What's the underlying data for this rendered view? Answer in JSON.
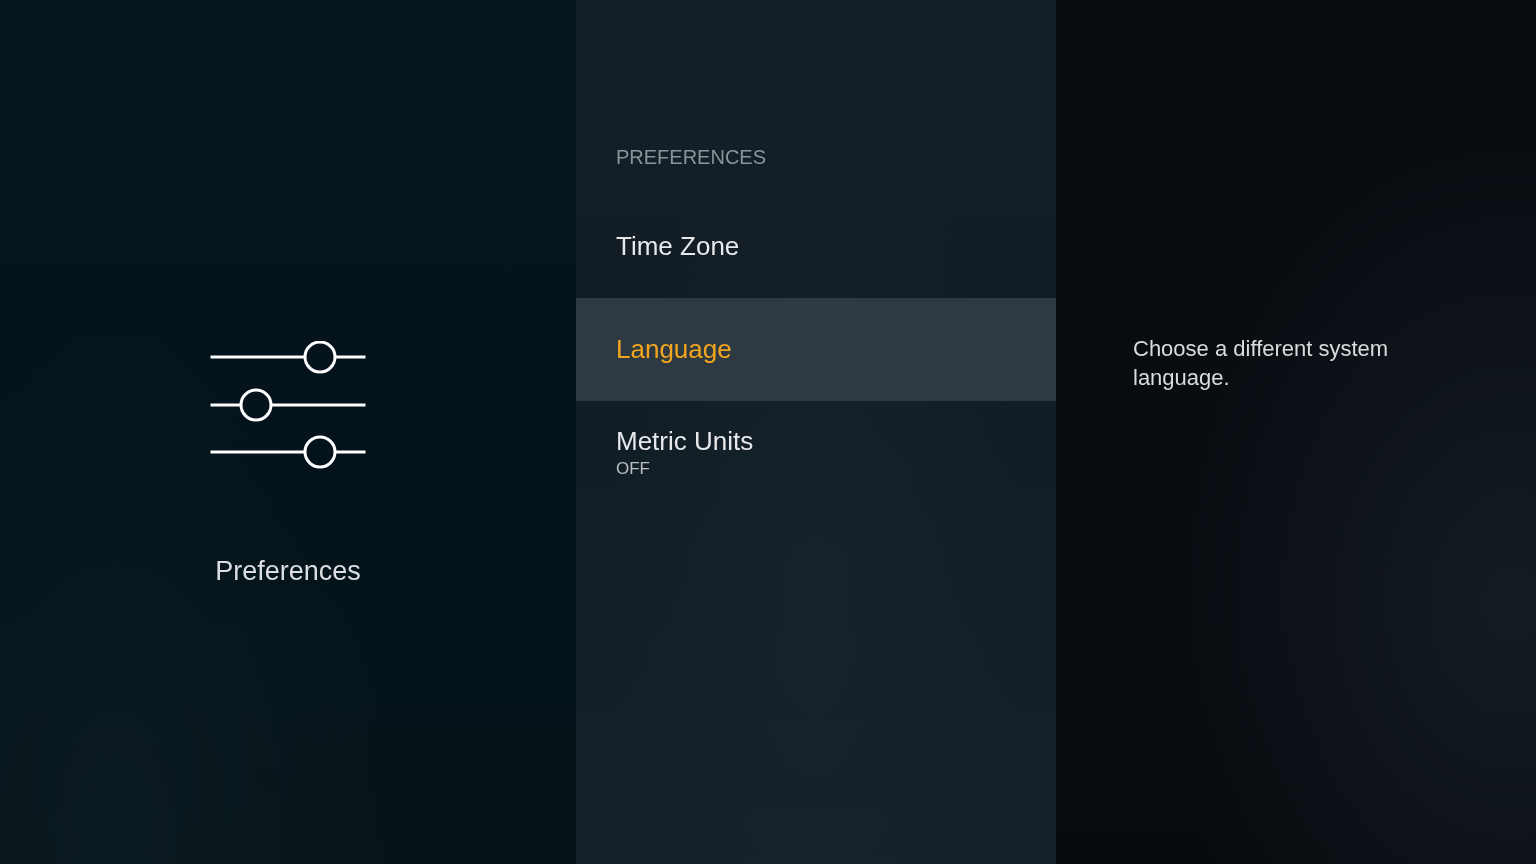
{
  "category": {
    "title": "Preferences"
  },
  "menu": {
    "heading": "PREFERENCES",
    "items": [
      {
        "label": "Time Zone",
        "selected": false
      },
      {
        "label": "Language",
        "selected": true
      },
      {
        "label": "Metric Units",
        "value": "OFF",
        "selected": false
      }
    ]
  },
  "description": {
    "text": "Choose a different system language."
  }
}
